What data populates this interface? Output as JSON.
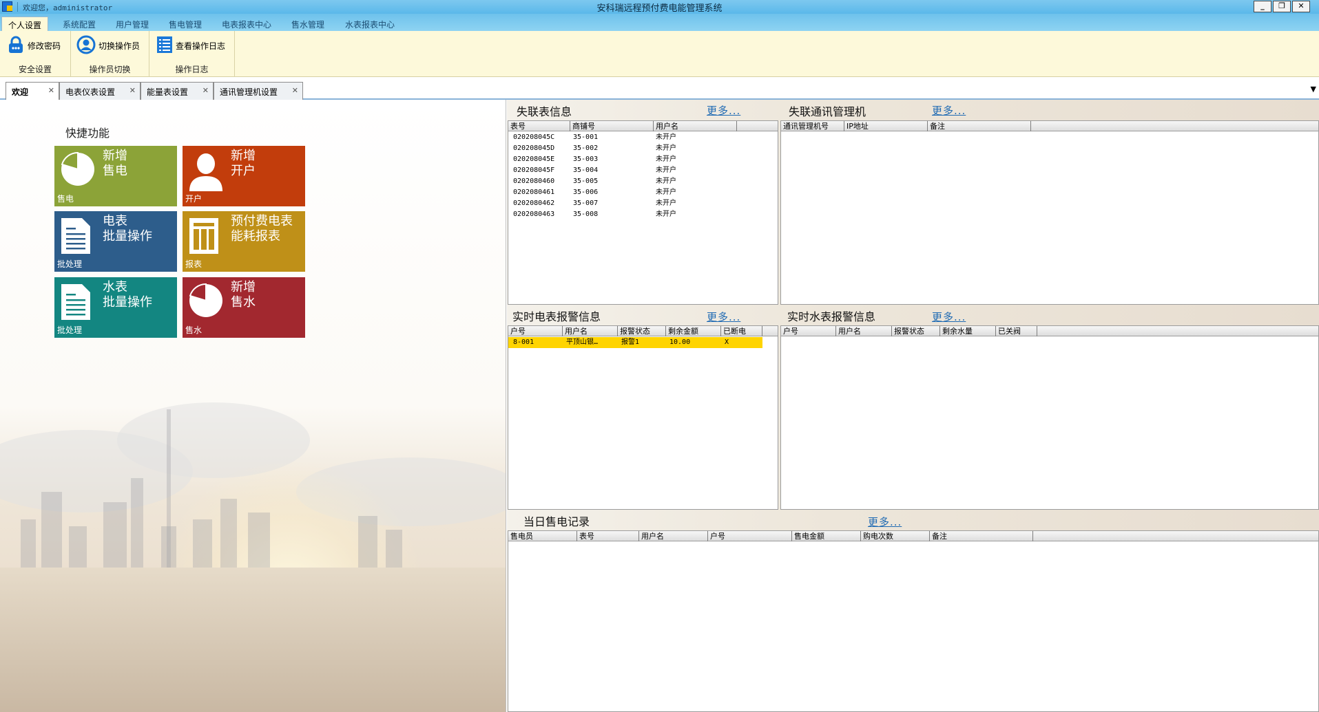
{
  "window": {
    "title": "安科瑞远程预付费电能管理系统",
    "welcome": "欢迎您，administrator",
    "buttons": [
      "_",
      "❐",
      "✕"
    ]
  },
  "menu": {
    "items": [
      "个人设置",
      "系统配置",
      "用户管理",
      "售电管理",
      "电表报表中心",
      "售水管理",
      "水表报表中心"
    ],
    "active": "个人设置"
  },
  "ribbon": {
    "groups": [
      {
        "button": "修改密码",
        "label": "安全设置",
        "icon": "lock-icon"
      },
      {
        "button": "切换操作员",
        "label": "操作员切换",
        "icon": "user-switch-icon"
      },
      {
        "button": "查看操作日志",
        "label": "操作日志",
        "icon": "log-list-icon"
      }
    ]
  },
  "doctabs": [
    {
      "label": "欢迎",
      "active": true
    },
    {
      "label": "电表仪表设置",
      "active": false
    },
    {
      "label": "能量表设置",
      "active": false
    },
    {
      "label": "通讯管理机设置",
      "active": false
    }
  ],
  "quick": {
    "title": "快捷功能",
    "tiles": [
      {
        "big": "新增\n售电",
        "small": "售电",
        "color": "#8ca338",
        "icon": "pie-chart-icon"
      },
      {
        "big": "新增\n开户",
        "small": "开户",
        "color": "#c23d0c",
        "icon": "user-icon"
      },
      {
        "big": "电表\n批量操作",
        "small": "批处理",
        "color": "#2d5d8b",
        "icon": "document-icon"
      },
      {
        "big": "预付费电表\n能耗报表",
        "small": "报表",
        "color": "#bf9018",
        "icon": "report-icon"
      },
      {
        "big": "水表\n批量操作",
        "small": "批处理",
        "color": "#138681",
        "icon": "document-icon"
      },
      {
        "big": "新增\n售水",
        "small": "售水",
        "color": "#a2282f",
        "icon": "pie-chart-icon"
      }
    ]
  },
  "more_label": "更多...",
  "offline_meters": {
    "title": "失联表信息",
    "columns": [
      "表号",
      "商铺号",
      "用户名"
    ],
    "rows": [
      [
        "020208045C",
        "35-001",
        "未开户"
      ],
      [
        "020208045D",
        "35-002",
        "未开户"
      ],
      [
        "020208045E",
        "35-003",
        "未开户"
      ],
      [
        "020208045F",
        "35-004",
        "未开户"
      ],
      [
        "0202080460",
        "35-005",
        "未开户"
      ],
      [
        "0202080461",
        "35-006",
        "未开户"
      ],
      [
        "0202080462",
        "35-007",
        "未开户"
      ],
      [
        "0202080463",
        "35-008",
        "未开户"
      ]
    ]
  },
  "offline_comm": {
    "title": "失联通讯管理机",
    "columns": [
      "通讯管理机号",
      "IP地址",
      "备注"
    ],
    "rows": []
  },
  "elec_alarm": {
    "title": "实时电表报警信息",
    "columns": [
      "户号",
      "用户名",
      "报警状态",
      "剩余金额",
      "已断电"
    ],
    "rows": [
      [
        "8-001",
        "平顶山银…",
        "报警1",
        "10.00",
        "X"
      ]
    ]
  },
  "water_alarm": {
    "title": "实时水表报警信息",
    "columns": [
      "户号",
      "用户名",
      "报警状态",
      "剩余水量",
      "已关阀"
    ],
    "rows": []
  },
  "sales_today": {
    "title": "当日售电记录",
    "columns": [
      "售电员",
      "表号",
      "用户名",
      "户号",
      "售电金额",
      "购电次数",
      "备注"
    ],
    "rows": []
  }
}
